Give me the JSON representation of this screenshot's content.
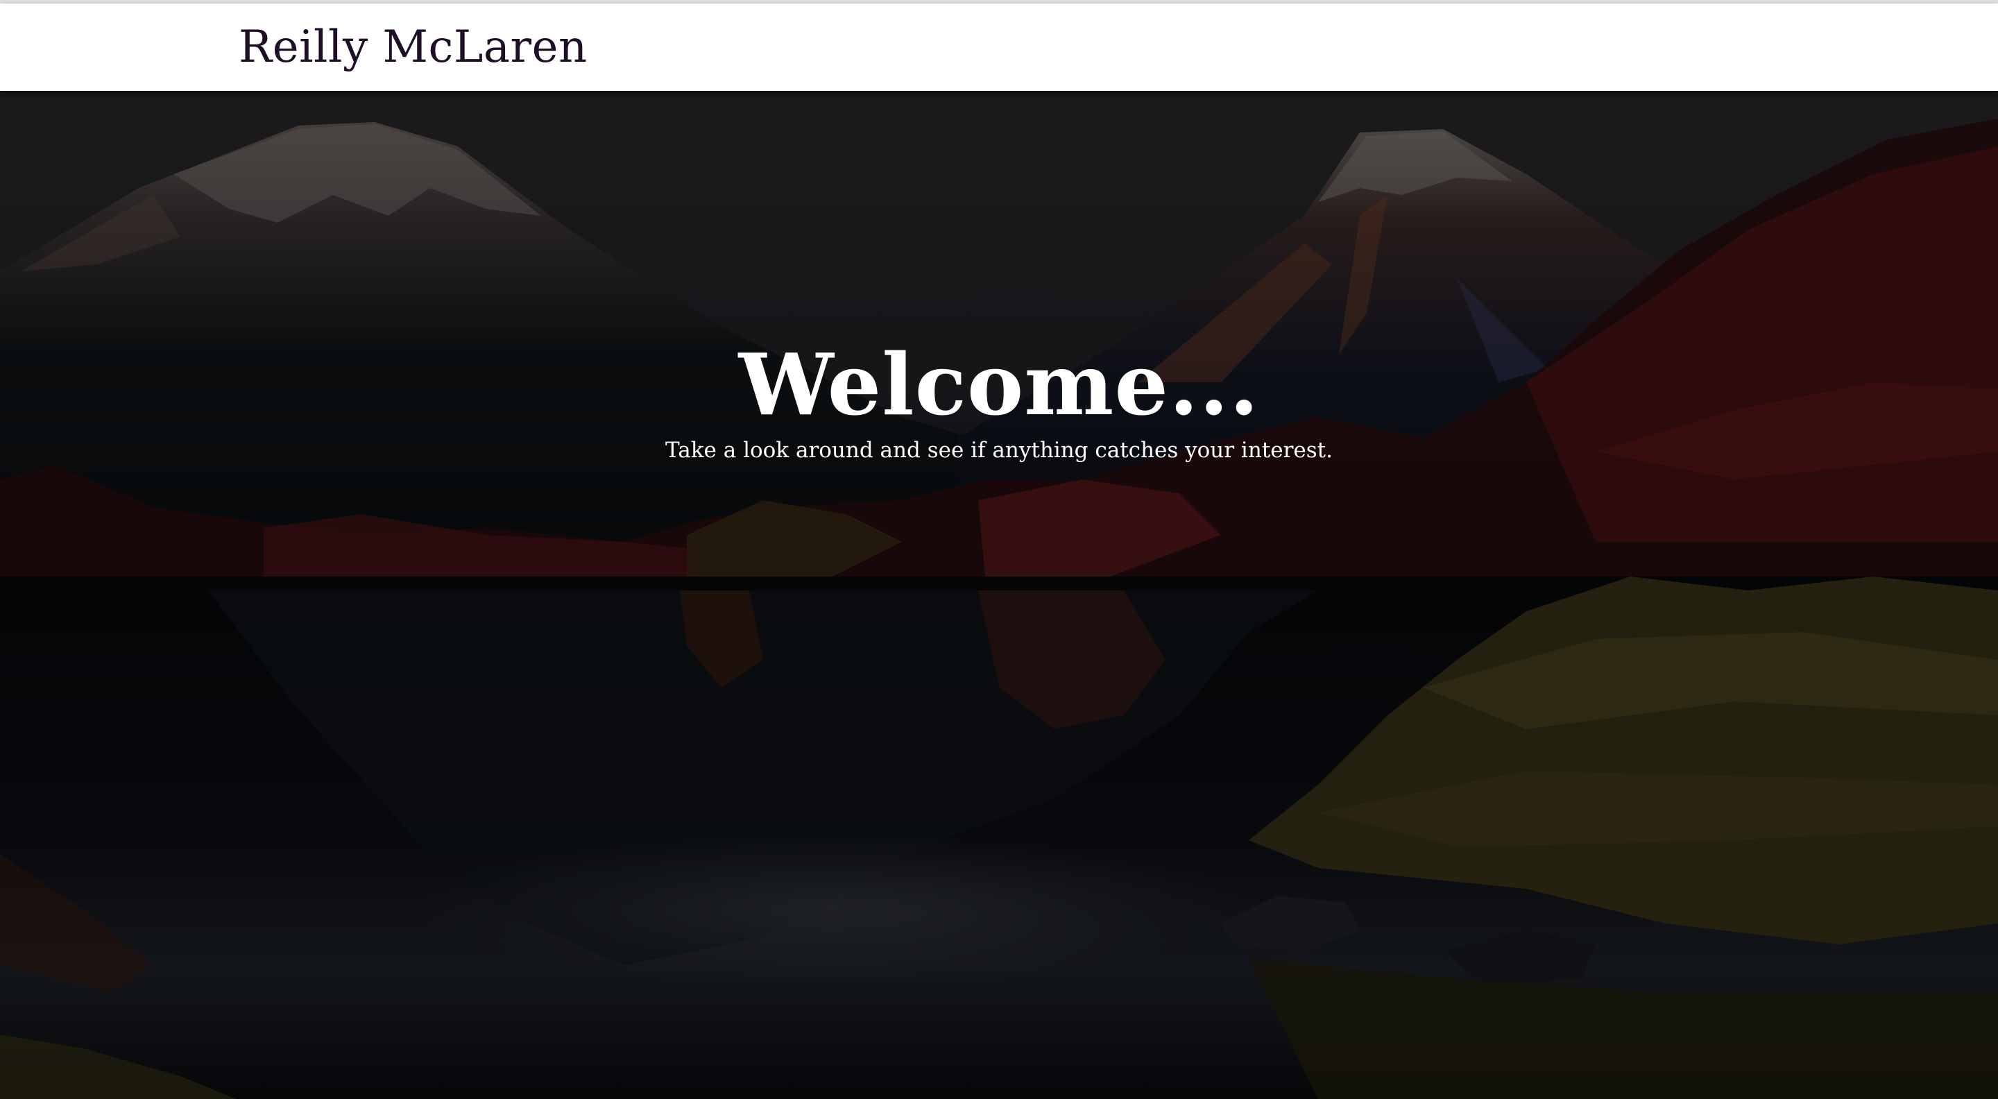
{
  "header": {
    "brand": "Reilly McLaren"
  },
  "hero": {
    "title": "Welcome...",
    "subtitle": "Take a look around and see if anything catches your interest.",
    "background_image": "landscape-mountains-lake-autumn"
  },
  "colors": {
    "brand_text": "#1f0f26",
    "navbar_bg": "#ffffff",
    "hero_text": "#ffffff"
  }
}
